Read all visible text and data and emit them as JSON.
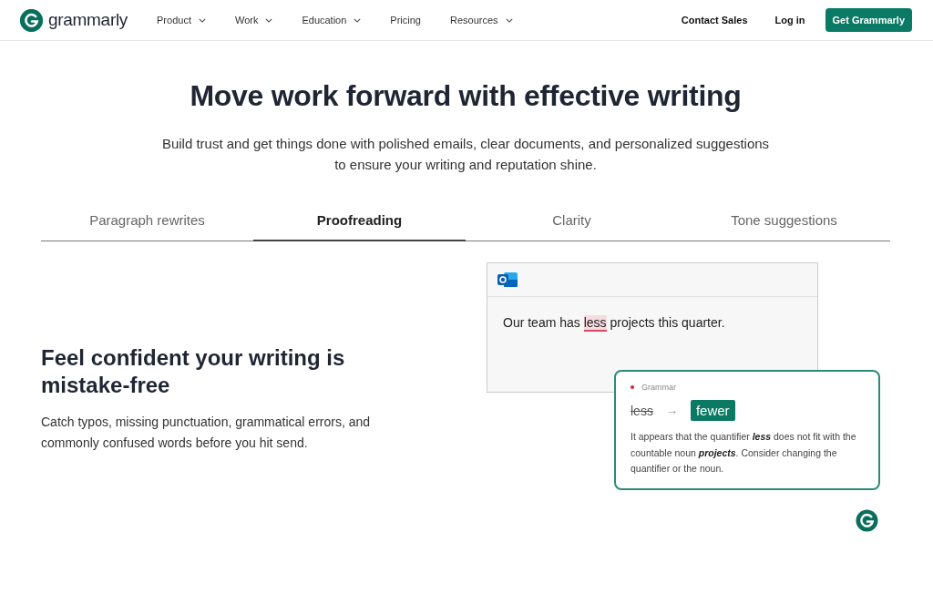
{
  "nav": {
    "logo": "grammarly",
    "items": [
      {
        "label": "Product",
        "dropdown": true
      },
      {
        "label": "Work",
        "dropdown": true
      },
      {
        "label": "Education",
        "dropdown": true
      },
      {
        "label": "Pricing",
        "dropdown": false
      },
      {
        "label": "Resources",
        "dropdown": true
      }
    ],
    "contact": "Contact Sales",
    "login": "Log in",
    "cta": "Get Grammarly"
  },
  "hero": {
    "title": "Move work forward with effective writing",
    "subtitle": "Build trust and get things done with polished emails, clear documents, and personalized suggestions to ensure your writing and reputation shine."
  },
  "tabs": [
    {
      "label": "Paragraph rewrites",
      "selected": false
    },
    {
      "label": "Proofreading",
      "selected": true
    },
    {
      "label": "Clarity",
      "selected": false
    },
    {
      "label": "Tone suggestions",
      "selected": false
    }
  ],
  "feature": {
    "heading": "Feel confident your writing is mistake-free",
    "body": "Catch typos, missing punctuation, grammatical errors, and commonly confused words before you hit send."
  },
  "email": {
    "before": "Our team has",
    "flagged": "less",
    "after": "projects this quarter."
  },
  "suggestion": {
    "category": "Grammar",
    "original": "less",
    "arrow": "→",
    "replacement": "fewer",
    "explanation": "It appears that the quantifier **less** does not fit with the countable noun **projects**. Consider changing the quantifier or the noun."
  }
}
